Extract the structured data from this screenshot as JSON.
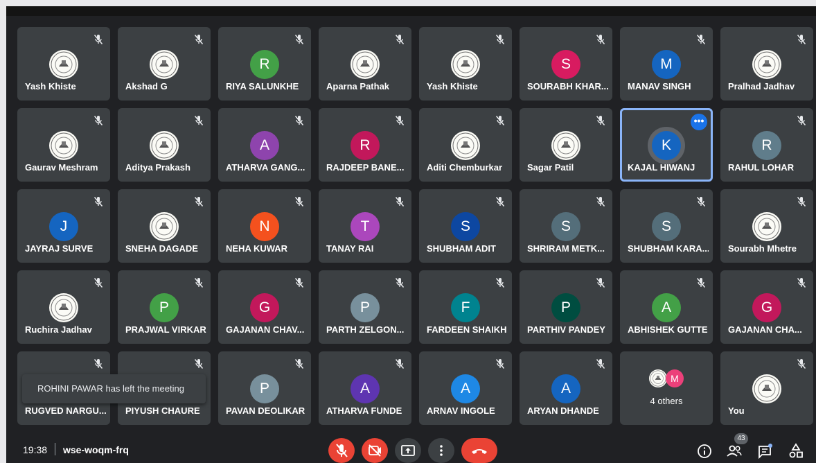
{
  "meeting": {
    "time": "19:38",
    "code": "wse-woqm-frq",
    "participant_count": "43"
  },
  "toast": "ROHINI PAWAR has left the meeting",
  "colors": {
    "background": "#202124",
    "tile": "#3c4043",
    "end_call": "#ea4335",
    "active_border": "#8ab4f8"
  },
  "participants": [
    {
      "name": "Yash Khiste",
      "avatar": "logo"
    },
    {
      "name": "Akshad G",
      "avatar": "logo"
    },
    {
      "name": "RIYA SALUNKHE",
      "avatar": "R",
      "color": "#43a047"
    },
    {
      "name": "Aparna Pathak",
      "avatar": "logo"
    },
    {
      "name": "Yash Khiste",
      "avatar": "logo"
    },
    {
      "name": "SOURABH KHAR...",
      "avatar": "S",
      "color": "#d81b60"
    },
    {
      "name": "MANAV SINGH",
      "avatar": "M",
      "color": "#1565c0"
    },
    {
      "name": "Pralhad Jadhav",
      "avatar": "logo"
    },
    {
      "name": "Gaurav Meshram",
      "avatar": "logo"
    },
    {
      "name": "Aditya Prakash",
      "avatar": "logo"
    },
    {
      "name": "ATHARVA GANG...",
      "avatar": "A",
      "color": "#8e44ad"
    },
    {
      "name": "RAJDEEP BANE...",
      "avatar": "R",
      "color": "#c2185b"
    },
    {
      "name": "Aditi Chemburkar",
      "avatar": "logo"
    },
    {
      "name": "Sagar Patil",
      "avatar": "logo"
    },
    {
      "name": "KAJAL HIWANJ",
      "avatar": "K",
      "color": "#1565c0",
      "active": true
    },
    {
      "name": "RAHUL LOHAR",
      "avatar": "R",
      "color": "#607d8b"
    },
    {
      "name": "JAYRAJ SURVE",
      "avatar": "J",
      "color": "#1565c0"
    },
    {
      "name": "SNEHA DAGADE",
      "avatar": "logo"
    },
    {
      "name": "NEHA KUWAR",
      "avatar": "N",
      "color": "#f4511e"
    },
    {
      "name": "TANAY RAI",
      "avatar": "T",
      "color": "#ab47bc"
    },
    {
      "name": "SHUBHAM ADIT",
      "avatar": "S",
      "color": "#0d47a1"
    },
    {
      "name": "SHRIRAM METK...",
      "avatar": "S",
      "color": "#546e7a"
    },
    {
      "name": "SHUBHAM KARA...",
      "avatar": "S",
      "color": "#546e7a"
    },
    {
      "name": "Sourabh Mhetre",
      "avatar": "logo"
    },
    {
      "name": "Ruchira Jadhav",
      "avatar": "logo"
    },
    {
      "name": "PRAJWAL VIRKAR",
      "avatar": "P",
      "color": "#43a047"
    },
    {
      "name": "GAJANAN CHAV...",
      "avatar": "G",
      "color": "#c2185b"
    },
    {
      "name": "PARTH ZELGON...",
      "avatar": "P",
      "color": "#78909c"
    },
    {
      "name": "FARDEEN SHAIKH",
      "avatar": "F",
      "color": "#00838f"
    },
    {
      "name": "PARTHIV PANDEY",
      "avatar": "P",
      "color": "#004d40"
    },
    {
      "name": "ABHISHEK GUTTE",
      "avatar": "A",
      "color": "#43a047"
    },
    {
      "name": "GAJANAN CHA...",
      "avatar": "G",
      "color": "#c2185b"
    },
    {
      "name": "RUGVED NARGU...",
      "avatar": "none"
    },
    {
      "name": "PIYUSH CHAURE",
      "avatar": "none"
    },
    {
      "name": "PAVAN DEOLIKAR",
      "avatar": "P",
      "color": "#78909c"
    },
    {
      "name": "ATHARVA FUNDE",
      "avatar": "A",
      "color": "#5e35b1"
    },
    {
      "name": "ARNAV INGOLE",
      "avatar": "A",
      "color": "#1e88e5"
    },
    {
      "name": "ARYAN DHANDE",
      "avatar": "A",
      "color": "#1565c0"
    }
  ],
  "others_tile": {
    "label": "4 others",
    "avatar_letter": "M",
    "avatar_color": "#ec407a"
  },
  "you_tile": {
    "name": "You"
  },
  "controls": {
    "mic": "mic-off-icon",
    "camera": "camera-off-icon",
    "present": "present-screen-icon",
    "more": "more-options-icon",
    "end": "end-call-icon",
    "info": "info-icon",
    "people": "people-icon",
    "chat": "chat-icon",
    "activities": "activities-icon"
  }
}
